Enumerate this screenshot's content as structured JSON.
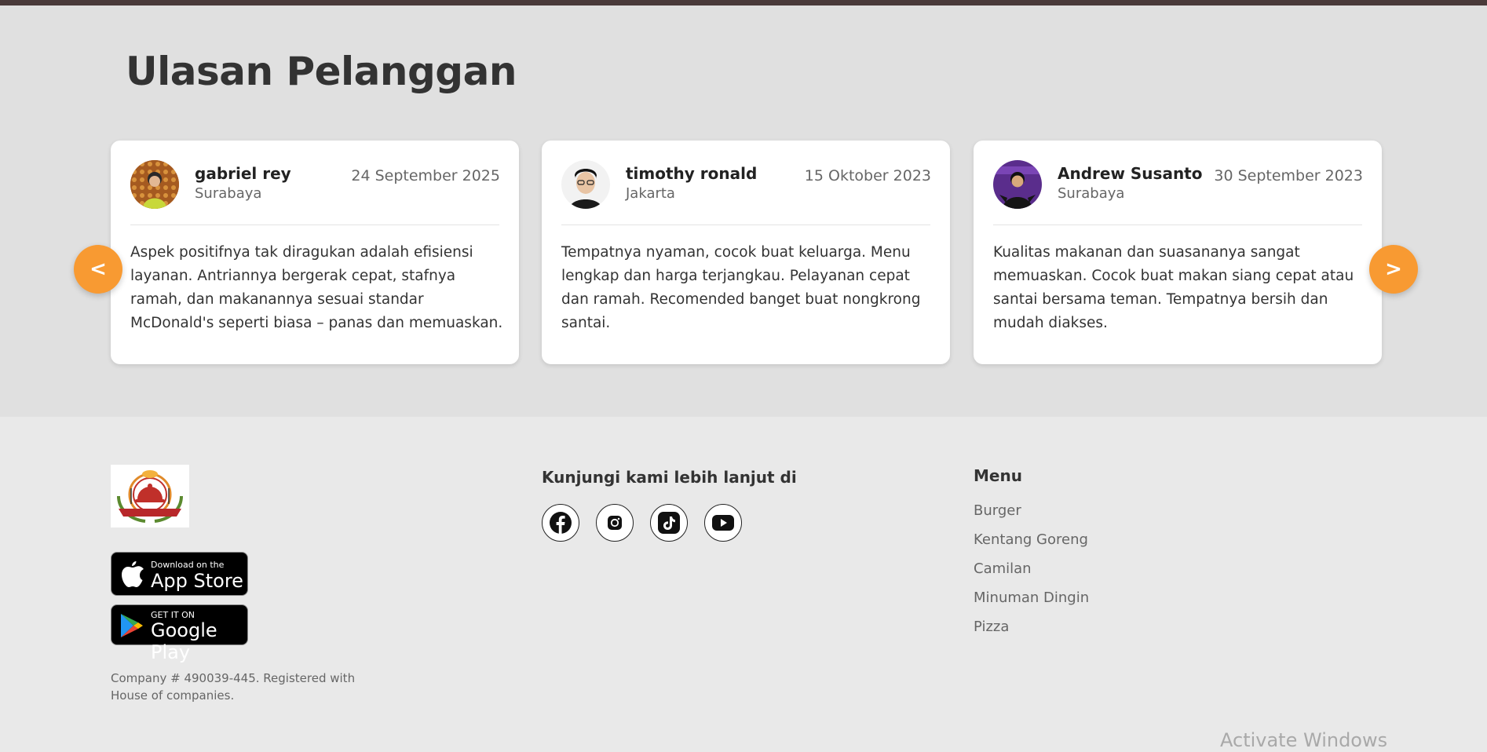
{
  "section": {
    "title": "Ulasan Pelanggan"
  },
  "reviews": [
    {
      "name": "gabriel rey",
      "city": "Surabaya",
      "date": "24 September 2025",
      "text": "Aspek positifnya tak diragukan adalah efisiensi layanan. Antriannya bergerak cepat, stafnya ramah, dan makanannya sesuai standar McDonald's seperti biasa – panas dan memuaskan."
    },
    {
      "name": "timothy ronald",
      "city": "Jakarta",
      "date": "15 Oktober 2023",
      "text": "Tempatnya nyaman, cocok buat keluarga. Menu lengkap dan harga terjangkau. Pelayanan cepat dan ramah. Recomended banget buat nongkrong santai."
    },
    {
      "name": "Andrew Susanto",
      "city": "Surabaya",
      "date": "30 September 2023",
      "text": "Kualitas makanan dan suasananya sangat memuaskan. Cocok buat makan siang cepat atau santai bersama teman. Tempatnya bersih dan mudah diakses."
    }
  ],
  "carousel": {
    "prev_label": "<",
    "next_label": ">"
  },
  "footer": {
    "app_store": {
      "small": "Download on the",
      "big": "App Store"
    },
    "google_play": {
      "small": "GET IT ON",
      "big": "Google Play"
    },
    "company": "Company # 490039-445. Registered with House of companies.",
    "visit_title": "Kunjungi kami lebih lanjut di",
    "social_icons": [
      "facebook-icon",
      "instagram-icon",
      "tiktok-icon",
      "youtube-icon"
    ],
    "menu_title": "Menu",
    "menu_items": [
      "Burger",
      "Kentang Goreng",
      "Camilan",
      "Minuman Dingin",
      "Pizza"
    ]
  },
  "watermark": "Activate Windows",
  "colors": {
    "accent": "#f89a32",
    "top_bar": "#4a3a3a",
    "section_bg": "#e0e0e0",
    "footer_bg": "#e9e9e9"
  }
}
